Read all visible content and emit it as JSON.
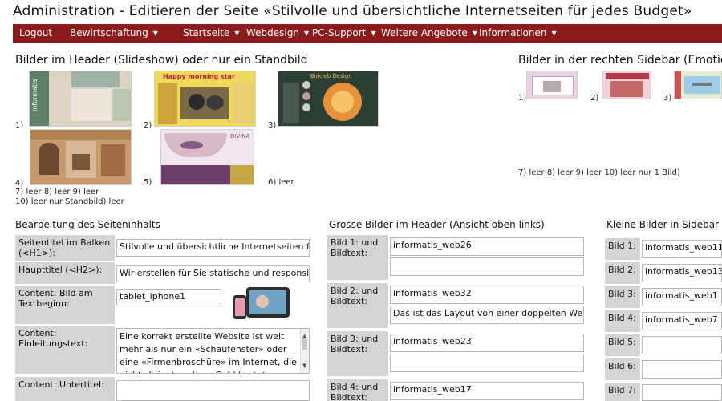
{
  "header": {
    "title": "Administration - Editieren der Seite «Stilvolle und übersichtliche Internetseiten für jedes Budget»"
  },
  "nav": {
    "items": [
      {
        "label": "Logout",
        "dropdown": false
      },
      {
        "label": "Bewirtschaftung",
        "dropdown": true
      },
      {
        "label": "Startseite",
        "dropdown": true
      },
      {
        "label": "Webdesign",
        "dropdown": true
      },
      {
        "label": "PC-Support",
        "dropdown": true
      },
      {
        "label": "Weitere Angebote",
        "dropdown": true
      },
      {
        "label": "Informationen",
        "dropdown": true
      }
    ],
    "caret": "▼"
  },
  "header_images": {
    "title": "Bilder im Header (Slideshow) oder nur ein Standbild",
    "labels": [
      "1)",
      "2)",
      "3)",
      "4)",
      "5)",
      "6) leer"
    ],
    "empty_row1": "7)   leer        8) leer     9) leer",
    "empty_row2": "10) leer                  nur Standbild) leer"
  },
  "sidebar_images": {
    "title": "Bilder in der rechten Sidebar (Emotic",
    "labels": [
      "1)",
      "2)",
      "3)"
    ],
    "empty_row": "7) leer       8) leer      9) leer      10) leer             nur 1 Bild)"
  },
  "content_edit": {
    "title": "Bearbeitung des Seiteninhalts",
    "fields": [
      {
        "label": "Seitentitel im Balken (<H1>):",
        "value": "Stilvolle und übersichtliche Internetseiten für j"
      },
      {
        "label": "Haupttitel (<H2>):",
        "value": "Wir erstellen für Sie statische und responsive In"
      },
      {
        "label": "Content: Bild am Textbeginn:",
        "value": "tablet_iphone1"
      },
      {
        "label": "Content: Einleitungstext:",
        "value": "Eine korrekt erstellte Website ist weit mehr als nur ein «Schaufenster» oder eine «Firmenbroschüre» im Internet, die nichts bringt und nur Geld kostet. Machen Sie Ihre"
      },
      {
        "label": "Content: Untertitel:",
        "value": ""
      }
    ]
  },
  "big_images": {
    "title": "Grosse Bilder im Header (Ansicht oben links)",
    "rows": [
      {
        "label": "Bild 1: und Bildtext:",
        "image": "informatis_web26",
        "text": ""
      },
      {
        "label": "Bild 2: und Bildtext:",
        "image": "informatis_web32",
        "text": "Das ist das Layout von einer doppelten Website"
      },
      {
        "label": "Bild 3: und Bildtext:",
        "image": "informatis_web23",
        "text": ""
      },
      {
        "label": "Bild 4: und Bildtext:",
        "image": "informatis_web17",
        "text": ""
      }
    ]
  },
  "small_images": {
    "title": "Kleine Bilder in Sidebar re",
    "rows": [
      {
        "label": "Bild 1:",
        "value": "informatis_web11"
      },
      {
        "label": "Bild 2:",
        "value": "informatis_web13"
      },
      {
        "label": "Bild 3:",
        "value": "informatis_web1"
      },
      {
        "label": "Bild 4:",
        "value": "informatis_web7"
      },
      {
        "label": "Bild 5:",
        "value": ""
      },
      {
        "label": "Bild 6:",
        "value": ""
      },
      {
        "label": "Bild 7:",
        "value": ""
      }
    ]
  },
  "thumbnails": {
    "t1": "informatis",
    "t2": "Happy morning star",
    "t3": "Birkreb Design",
    "t5": "DIVINA"
  }
}
